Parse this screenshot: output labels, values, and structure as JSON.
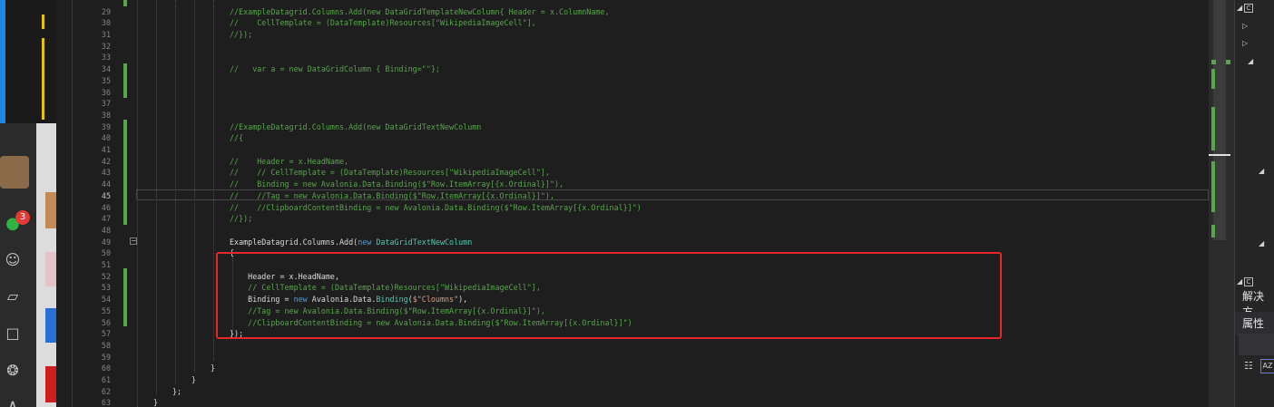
{
  "chat_sidebar": {
    "unread_badge": "3",
    "icons": [
      "chat-icon",
      "contacts-icon",
      "cube-icon",
      "folder-icon",
      "aperture-icon",
      "more-icon"
    ]
  },
  "editor": {
    "current_line": "45",
    "lines": [
      {
        "n": "29",
        "code": "//ExampleDatagrid.Columns.Add(new DataGridTemplateNewColumn{ Header = x.ColumnName,"
      },
      {
        "n": "30",
        "code": "//    CellTemplate = (DataTemplate)Resources[\"WikipediaImageCell\"],"
      },
      {
        "n": "31",
        "code": "//});"
      },
      {
        "n": "32",
        "code": ""
      },
      {
        "n": "33",
        "code": ""
      },
      {
        "n": "34",
        "code": "//   var a = new DataGridColumn { Binding=\"\"};"
      },
      {
        "n": "35",
        "code": ""
      },
      {
        "n": "36",
        "code": ""
      },
      {
        "n": "37",
        "code": ""
      },
      {
        "n": "38",
        "code": ""
      },
      {
        "n": "39",
        "code": "//ExampleDatagrid.Columns.Add(new DataGridTextNewColumn"
      },
      {
        "n": "40",
        "code": "//{"
      },
      {
        "n": "41",
        "code": ""
      },
      {
        "n": "42",
        "code": "//    Header = x.HeadName,"
      },
      {
        "n": "43",
        "code": "//    // CellTemplate = (DataTemplate)Resources[\"WikipediaImageCell\"],"
      },
      {
        "n": "44",
        "code": "//    Binding = new Avalonia.Data.Binding($\"Row.ItemArray[{x.Ordinal}]\"),"
      },
      {
        "n": "45",
        "code": "//    //Tag = new Avalonia.Data.Binding($\"Row.ItemArray[{x.Ordinal}]\"),"
      },
      {
        "n": "46",
        "code": "//    //ClipboardContentBinding = new Avalonia.Data.Binding($\"Row.ItemArray[{x.Ordinal}]\")"
      },
      {
        "n": "47",
        "code": "//});"
      },
      {
        "n": "48",
        "code": ""
      },
      {
        "n": "49",
        "code": "ExampleDatagrid.Columns.Add(new DataGridTextNewColumn"
      },
      {
        "n": "50",
        "code": "{"
      },
      {
        "n": "51",
        "code": ""
      },
      {
        "n": "52",
        "code": "    Header = x.HeadName,"
      },
      {
        "n": "53",
        "code": "    // CellTemplate = (DataTemplate)Resources[\"WikipediaImageCell\"],"
      },
      {
        "n": "54",
        "code": "    Binding = new Avalonia.Data.Binding($\"Cloumns\"),"
      },
      {
        "n": "55",
        "code": "    //Tag = new Avalonia.Data.Binding($\"Row.ItemArray[{x.Ordinal}]\"),"
      },
      {
        "n": "56",
        "code": "    //ClipboardContentBinding = new Avalonia.Data.Binding($\"Row.ItemArray[{x.Ordinal}]\")"
      },
      {
        "n": "57",
        "code": "});"
      },
      {
        "n": "58",
        "code": ""
      },
      {
        "n": "59",
        "code": ""
      },
      {
        "n": "60",
        "code": "}"
      },
      {
        "n": "61",
        "code": "}"
      },
      {
        "n": "62",
        "code": "};"
      },
      {
        "n": "63",
        "code": "}"
      }
    ]
  },
  "right_panel": {
    "solution_explorer_label": "解决方",
    "properties_label": "属性",
    "alpha_sort_label": "AZ"
  },
  "colors": {
    "comment": "#57a64a",
    "keyword": "#569cd6",
    "type": "#4ec9b0",
    "string": "#d69d85",
    "highlight_box": "#e8272a"
  }
}
